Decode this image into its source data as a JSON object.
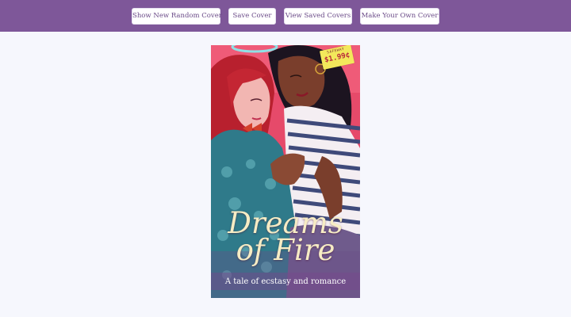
{
  "header": {
    "buttons": {
      "random": "Show New Random Cover",
      "save": "Save Cover",
      "view_saved": "View Saved Covers",
      "make_own": "Make Your Own Cover"
    }
  },
  "cover": {
    "title": "Dreams of Fire",
    "tagline": "A tale of ecstasy and romance",
    "price_tag": {
      "store": "SAFEWAY",
      "price": "$1.99¢"
    }
  },
  "colors": {
    "header_bg": "#7e5799",
    "page_bg": "#f6f7fd",
    "button_text": "#6b4b88",
    "title_text": "#f6ecc4"
  }
}
